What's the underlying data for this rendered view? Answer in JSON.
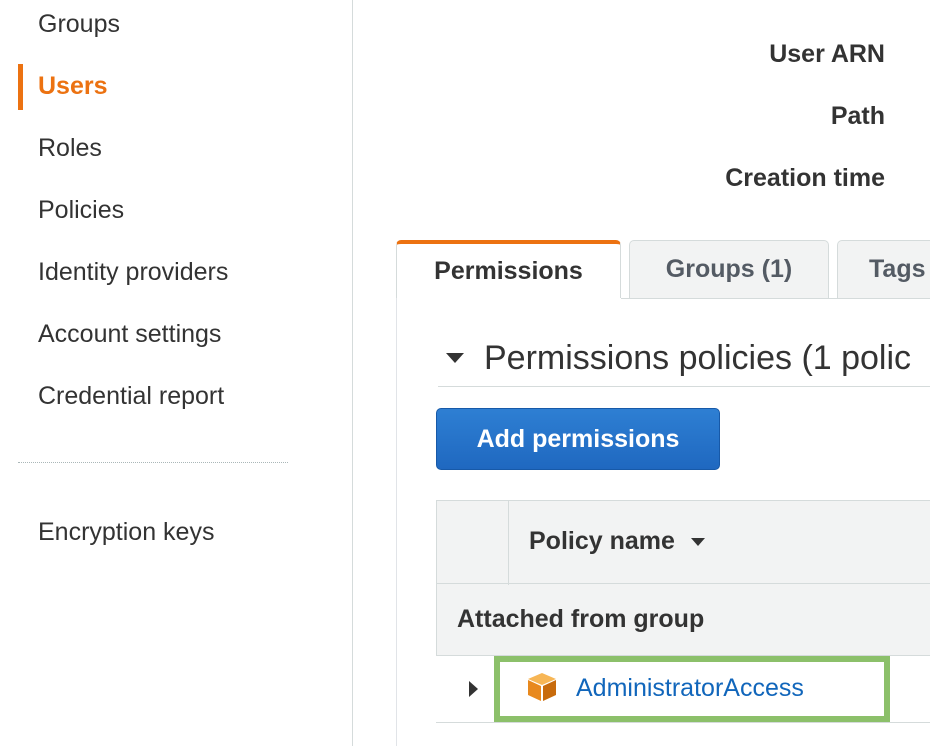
{
  "sidebar": {
    "items": [
      {
        "label": "Groups"
      },
      {
        "label": "Users",
        "active": true
      },
      {
        "label": "Roles"
      },
      {
        "label": "Policies"
      },
      {
        "label": "Identity providers"
      },
      {
        "label": "Account settings"
      },
      {
        "label": "Credential report"
      }
    ],
    "secondary_items": [
      {
        "label": "Encryption keys"
      }
    ]
  },
  "summary": {
    "labels": [
      "User ARN",
      "Path",
      "Creation time"
    ]
  },
  "tabs": [
    {
      "label": "Permissions",
      "active": true
    },
    {
      "label": "Groups (1)"
    },
    {
      "label": "Tags"
    }
  ],
  "permissions_section": {
    "title": "Permissions policies (1 polic",
    "add_button_label": "Add permissions"
  },
  "policy_table": {
    "columns": [
      "",
      "Policy name"
    ],
    "group_label": "Attached from group",
    "rows": [
      {
        "policy_name": "AdministratorAccess",
        "icon": "aws-managed-policy-cube-icon"
      }
    ]
  },
  "colors": {
    "accent_orange": "#ec7211",
    "button_blue": "#1f68c0",
    "link_blue": "#1166bb",
    "highlight_green": "#8cc06a"
  }
}
